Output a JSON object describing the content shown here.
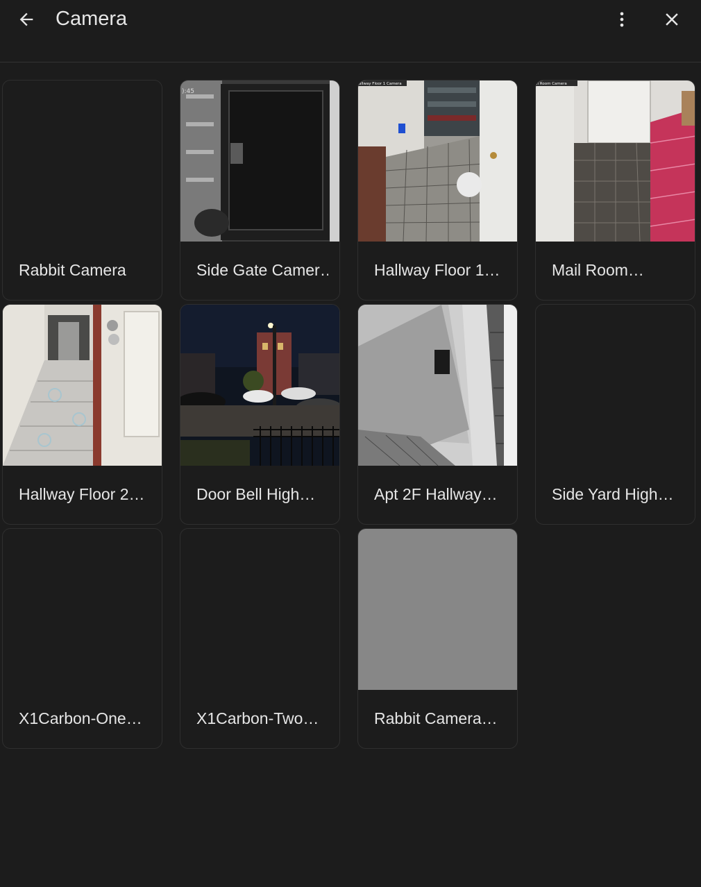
{
  "header": {
    "title": "Camera",
    "back_icon": "arrow-left-icon",
    "more_icon": "more-vertical-icon",
    "close_icon": "close-icon"
  },
  "cameras": [
    {
      "label": "Rabbit Camera",
      "thumbnail": "none"
    },
    {
      "label": "Side Gate Camer…",
      "thumbnail": "side-gate-door-night",
      "overlay_text": "):45"
    },
    {
      "label": "Hallway Floor 1…",
      "thumbnail": "hallway-floor-1",
      "overlay_text": "allway Floor 1 Camera"
    },
    {
      "label": "Mail Room…",
      "thumbnail": "mail-room",
      "overlay_text": "il Room Camera"
    },
    {
      "label": "Hallway Floor 2…",
      "thumbnail": "hallway-floor-2"
    },
    {
      "label": "Door Bell High…",
      "thumbnail": "street-night"
    },
    {
      "label": "Apt 2F Hallway…",
      "thumbnail": "apt-2f-hallway"
    },
    {
      "label": "Side Yard High…",
      "thumbnail": "none"
    },
    {
      "label": "X1Carbon-One…",
      "thumbnail": "none"
    },
    {
      "label": "X1Carbon-Two…",
      "thumbnail": "none"
    },
    {
      "label": "Rabbit Camera…",
      "thumbnail": "gray-placeholder"
    }
  ],
  "colors": {
    "background": "#1c1c1c",
    "card_border": "#2f2f2f",
    "text": "#e6e6e6",
    "placeholder_gray": "#878787"
  }
}
